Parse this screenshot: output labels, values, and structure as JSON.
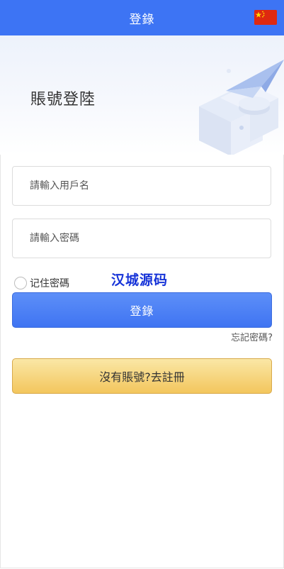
{
  "header": {
    "title": "登錄",
    "language_flag": "china-flag-icon"
  },
  "hero": {
    "title": "賬號登陸",
    "illustration": "paper-plane-blocks-illustration"
  },
  "form": {
    "username_placeholder": "請輸入用戶名",
    "password_placeholder": "請輸入密碼",
    "remember_label": "记住密碼",
    "login_label": "登錄",
    "forgot_label": "忘記密碼?",
    "register_label": "沒有賬號?去註冊"
  },
  "watermark": "汉城源码",
  "colors": {
    "primary": "#3d74f4",
    "register_gold": "#f3c65d",
    "watermark": "#1633d8"
  }
}
